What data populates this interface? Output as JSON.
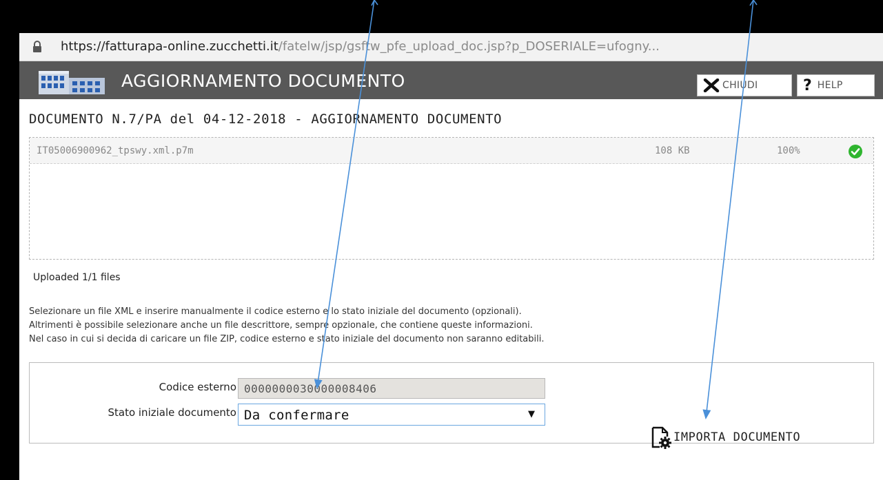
{
  "browser": {
    "url_host": "https://fatturapa-online.zucchetti.it",
    "url_path": "/fatelw/jsp/gsftw_pfe_upload_doc.jsp?p_DOSERIALE=ufogny..."
  },
  "header": {
    "title": "AGGIORNAMENTO DOCUMENTO",
    "close_label": "CHIUDI",
    "help_label": "HELP"
  },
  "document": {
    "title": "DOCUMENTO N.7/PA del 04-12-2018 - AGGIORNAMENTO DOCUMENTO"
  },
  "upload": {
    "file_name": "IT05006900962_tpswy.xml.p7m",
    "file_size": "108 KB",
    "progress": "100%",
    "status": "Uploaded 1/1 files"
  },
  "instructions": [
    "Selezionare un file XML e inserire manualmente il codice esterno e lo stato iniziale del documento (opzionali).",
    "Altrimenti è possibile selezionare anche un file descrittore, sempre opzionale, che contiene queste informazioni.",
    "Nel caso in cui si decida di caricare un file ZIP, codice esterno e stato iniziale del documento non saranno editabili."
  ],
  "form": {
    "codice_label": "Codice esterno",
    "codice_value": "0000000030000008406",
    "stato_label": "Stato iniziale documento",
    "stato_value": "Da confermare"
  },
  "actions": {
    "import_label": "IMPORTA DOCUMENTO"
  },
  "colors": {
    "titlebar": "#585858",
    "success": "#2fb52f",
    "annotation_arrow": "#4a90d9"
  },
  "icons": [
    "lock-icon",
    "building-icon",
    "close-icon",
    "help-icon",
    "check-circle-icon",
    "document-gear-icon"
  ]
}
